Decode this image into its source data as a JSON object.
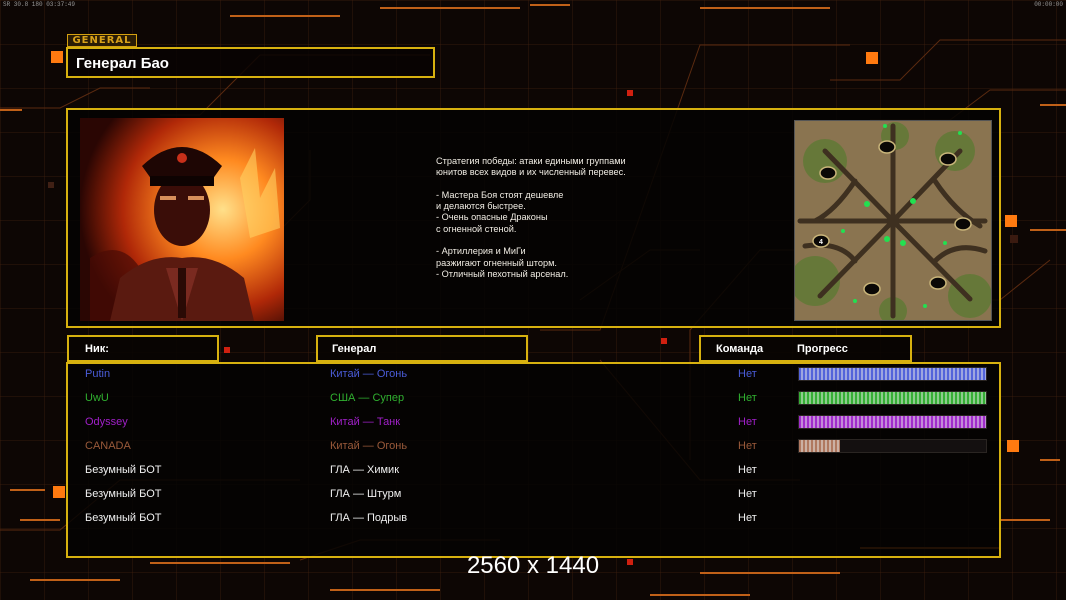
{
  "hud": {
    "left": "SR  30.8  180  03:37:49",
    "right": "00:00:00"
  },
  "general_tag": "GENERAL",
  "general_name": "Генерал Бао",
  "strategy_text": "Стратегия победы: атаки едиными группами\nюнитов всех видов и их численный перевес.\n\n- Мастера Боя стоят дешевле\nи делаются быстрее.\n- Очень опасные Драконы\nс огненной стеной.\n\n- Артиллерия и МиГи\nразжигают огненный шторм.\n- Отличный пехотный арсенал.",
  "minimap": {
    "start_label": "4"
  },
  "headers": {
    "nick": "Ник:",
    "general": "Генерал",
    "team": "Команда",
    "progress": "Прогресс"
  },
  "players": [
    {
      "nick": "Putin",
      "general": "Китай — Огонь",
      "team": "Нет",
      "color": "#4a5cd8",
      "progress": 1.0,
      "bar_color": "#5a6cf0"
    },
    {
      "nick": "UwU",
      "general": "США — Супер",
      "team": "Нет",
      "color": "#30b030",
      "progress": 1.0,
      "bar_color": "#39c039"
    },
    {
      "nick": "Odyssey",
      "general": "Китай — Танк",
      "team": "Нет",
      "color": "#a020c8",
      "progress": 1.0,
      "bar_color": "#b030e0"
    },
    {
      "nick": "CANADA",
      "general": "Китай — Огонь",
      "team": "Нет",
      "color": "#9a5a3a",
      "progress": 0.22,
      "bar_color": "#c08468"
    },
    {
      "nick": "Безумный БОТ",
      "general": "ГЛА — Химик",
      "team": "Нет",
      "color": "#f0f0f0",
      "progress": null,
      "bar_color": ""
    },
    {
      "nick": "Безумный БОТ",
      "general": "ГЛА — Штурм",
      "team": "Нет",
      "color": "#f0f0f0",
      "progress": null,
      "bar_color": ""
    },
    {
      "nick": "Безумный БОТ",
      "general": "ГЛА — Подрыв",
      "team": "Нет",
      "color": "#f0f0f0",
      "progress": null,
      "bar_color": ""
    }
  ],
  "watermark": "2560 x 1440",
  "colors": {
    "accent": "#d7b10f",
    "orange": "#ff7a10",
    "background": "#0d0604"
  }
}
